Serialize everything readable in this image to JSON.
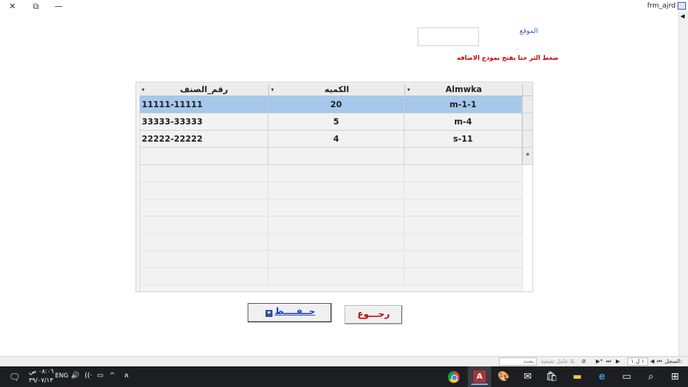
{
  "window": {
    "title": "frm_ajrd",
    "controls": [
      "close-icon",
      "restore-icon",
      "minimize-icon"
    ]
  },
  "form": {
    "location_label": "الموقع",
    "location_value": "",
    "hint": "ضغط الثر حتا يفتح نموذج الاضافه"
  },
  "grid": {
    "columns": [
      "رقم_الصنف",
      "الكميه",
      "Almwka"
    ],
    "rows": [
      {
        "item_no": "11111-11111",
        "qty": "20",
        "location": "m-1-1",
        "selected": true
      },
      {
        "item_no": "33333-33333",
        "qty": "5",
        "location": "m-4",
        "selected": false
      },
      {
        "item_no": "22222-22222",
        "qty": "4",
        "location": "s-11",
        "selected": false
      }
    ],
    "new_row_marker": "*"
  },
  "buttons": {
    "save_label": "حــفــــظ",
    "back_label": "رجـــوع"
  },
  "record_nav": {
    "record_label": "السجل:",
    "record_count": "١ ل ١",
    "filter_label": "بلا عامل تصفية",
    "search_label": "بحث"
  },
  "taskbar": {
    "time": "٠٨:٠٦ ص",
    "date": "٣٩/٠٧/١٣",
    "language": "ENG"
  },
  "colors": {
    "selected_row": "#a5c8ec",
    "hint_red": "#c00000",
    "save_blue": "#1b3fc9",
    "back_red": "#d00000"
  }
}
